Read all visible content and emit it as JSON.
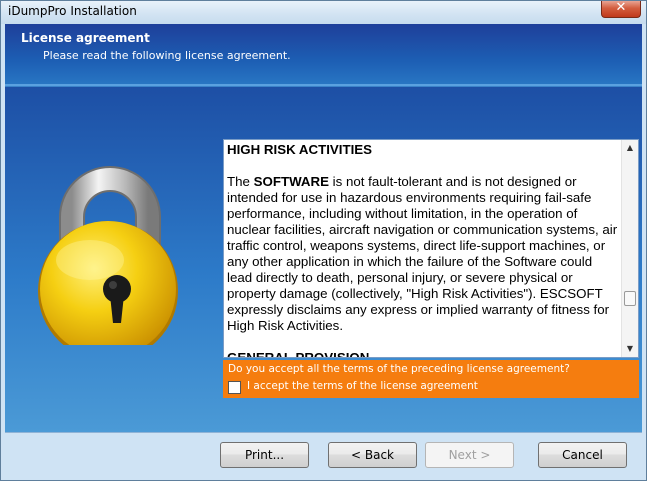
{
  "window": {
    "title": "iDumpPro Installation",
    "close_glyph": "✕"
  },
  "header": {
    "title": "License agreement",
    "subtitle": "Please read the following license agreement."
  },
  "license": {
    "section1_heading": "HIGH RISK ACTIVITIES",
    "para_the": "The ",
    "para_software": "SOFTWARE",
    "para_body": " is not fault-tolerant and is not designed or intended for use in hazardous environments requiring fail-safe performance, including without limitation, in the operation of nuclear facilities, aircraft navigation or communication systems, air traffic control, weapons systems, direct life-support machines, or any other application in which the failure of the Software could lead directly to death, personal injury, or severe physical or property damage (collectively, \"High Risk Activities\"). ESCSOFT expressly disclaims any express or implied warranty of fitness for High Risk Activities.",
    "section2_heading": "GENERAL PROVISION"
  },
  "acceptance": {
    "question": "Do you accept all the terms of the preceding license agreement?",
    "checkbox_label": "I accept the terms of the license agreement",
    "checked": false
  },
  "buttons": {
    "print": "Print...",
    "back": "< Back",
    "next": "Next >",
    "cancel": "Cancel"
  },
  "icons": {
    "lock": "padlock-icon",
    "close": "close-icon"
  },
  "colors": {
    "header": "#1e3f9a",
    "content": "#2d7bc9",
    "accept_panel": "#f57d0f",
    "lock_body": "#f2c400"
  }
}
